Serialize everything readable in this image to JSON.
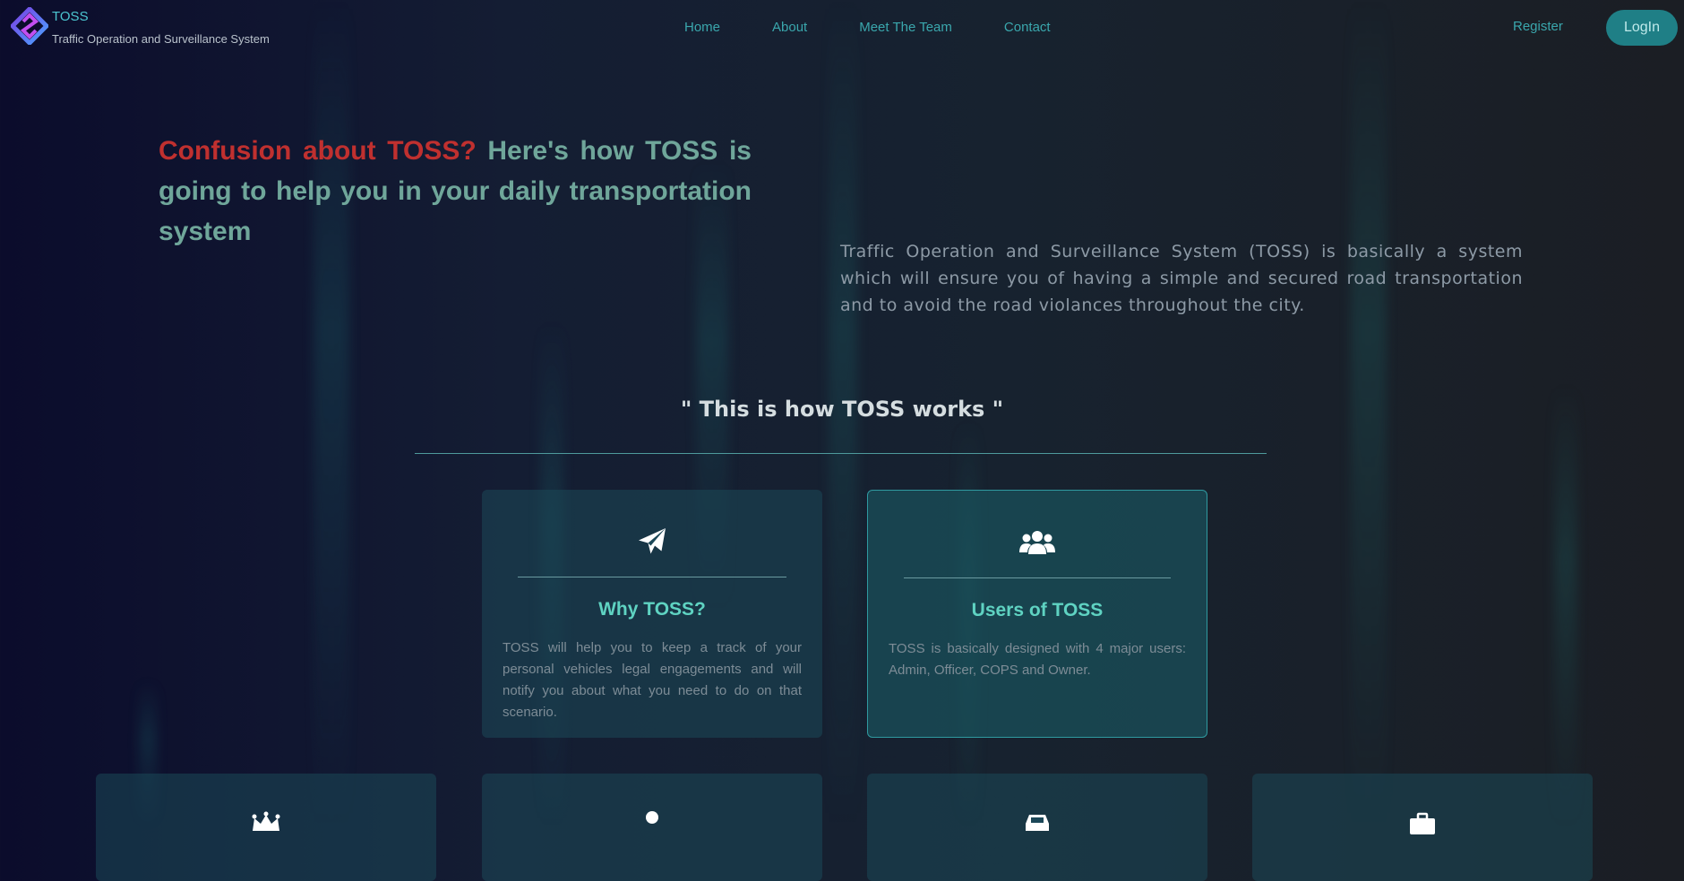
{
  "nav": {
    "brand_title": "TOSS",
    "brand_subtitle": "Traffic Operation and Surveillance System",
    "links": [
      "Home",
      "About",
      "Meet The Team",
      "Contact"
    ],
    "register_label": "Register",
    "login_label": "LogIn"
  },
  "hero": {
    "title_highlight": "Confusion about TOSS?",
    "title_rest": " Here's how TOSS is going to help you in your daily transportation system",
    "description": "Traffic Operation and Surveillance System (TOSS) is basically a system which will ensure you of having a simple and secured road transportation and to avoid the road violances throughout the city."
  },
  "works": {
    "title": "\" This is how TOSS works \""
  },
  "cards": [
    {
      "icon": "paper-plane-icon",
      "title": "Why TOSS?",
      "text": "TOSS will help you to keep a track of your personal vehicles legal engagements and will notify you about what you need to do on that scenario."
    },
    {
      "icon": "users-icon",
      "title": "Users of TOSS",
      "text": "TOSS is basically designed with 4 major users: Admin, Officer, COPS and Owner."
    }
  ],
  "bottom_cards": [
    {
      "icon": "crown-icon"
    },
    {
      "icon": "person-icon"
    },
    {
      "icon": "car-icon"
    },
    {
      "icon": "briefcase-icon"
    }
  ],
  "colors": {
    "accent": "#1f7f86",
    "highlight_red": "#c0302f",
    "card_title": "#5fd3c2"
  }
}
